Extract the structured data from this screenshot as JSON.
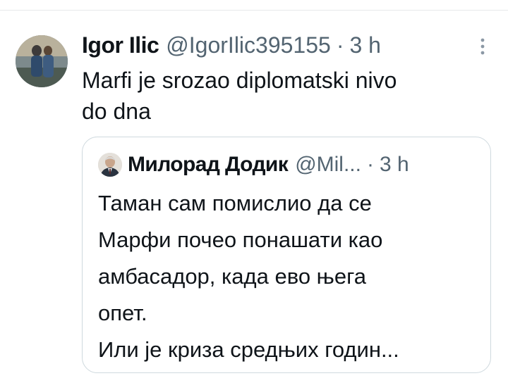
{
  "tweet": {
    "display_name": "Igor Ilic",
    "handle": "@IgorIlic395155",
    "separator": "·",
    "time": "3 h",
    "text_lines": [
      "Marfi je srozao diplomatski nivo",
      "do dna"
    ]
  },
  "quoted_tweet": {
    "display_name": "Милорад Додик",
    "handle": "@Mil...",
    "separator": "·",
    "time": "3 h",
    "text_lines": [
      "Таман сам помислио да се",
      "Марфи почео понашати као",
      "амбасадор, када ево њега",
      "опет.",
      "Или је криза средњих годин..."
    ]
  },
  "icons": {
    "more": "more-vertical-icon",
    "avatar": "user-avatar",
    "quote_avatar": "quoted-user-avatar"
  },
  "colors": {
    "text_primary": "#0f1419",
    "text_secondary": "#536471",
    "border": "#cfd9de",
    "background": "#ffffff"
  }
}
